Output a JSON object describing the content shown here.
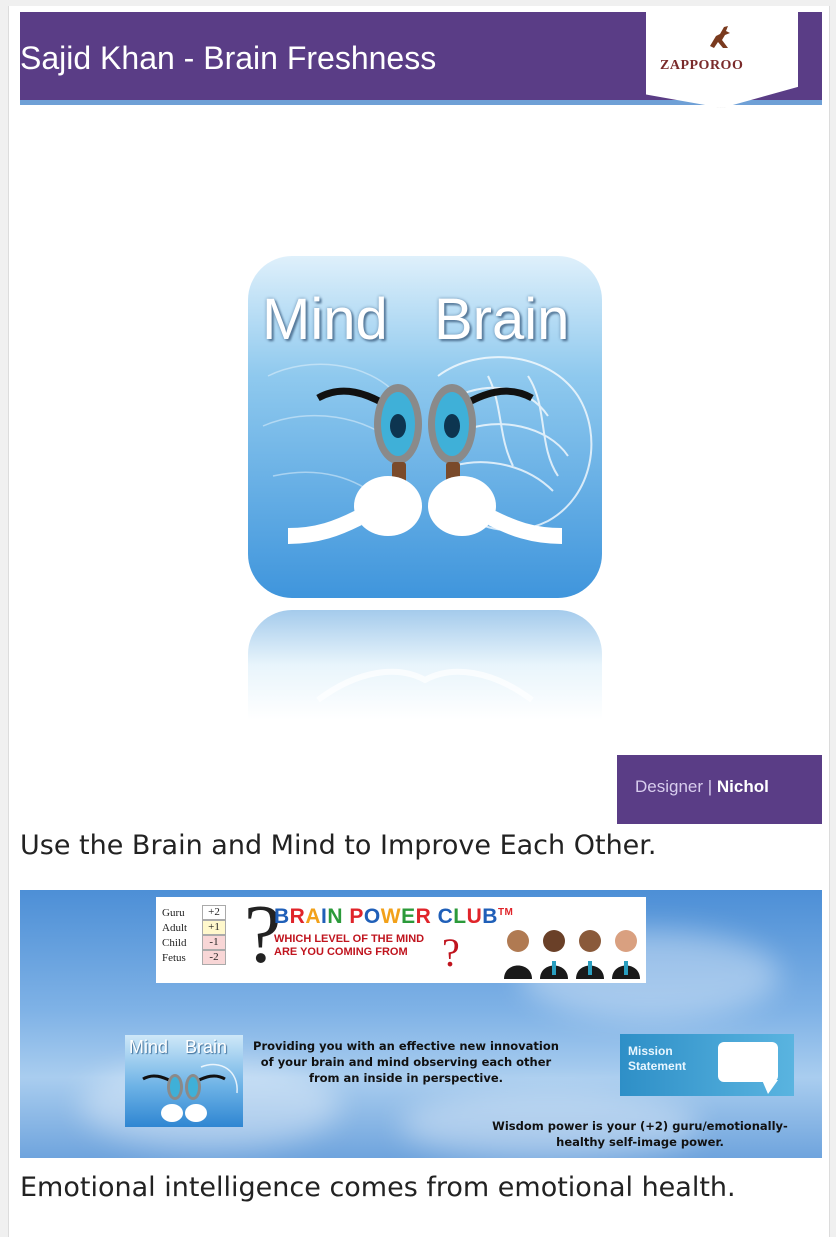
{
  "slide1": {
    "title": "Sajid Khan - Brain Freshness",
    "logo": "ZAPPOROO",
    "icon_words": [
      "Mind",
      "Brain"
    ],
    "designer_label": "Designer | ",
    "designer_name": "Nichol",
    "colors": {
      "header": "#5a3d86",
      "accent_line": "#6fa0d6",
      "icon_blue": "#3f95dc"
    }
  },
  "caption1": "Use the Brain and Mind to Improve Each Other.",
  "slide2": {
    "levels": [
      {
        "name": "Guru",
        "value": "+2",
        "color": "#ffffff"
      },
      {
        "name": "Adult",
        "value": "+1",
        "color": "#fff8cc"
      },
      {
        "name": "Child",
        "value": "-1",
        "color": "#f8d6d6"
      },
      {
        "name": "Fetus",
        "value": "-2",
        "color": "#f8d6d6"
      }
    ],
    "club_title": "BRAIN POWER CLUB",
    "club_tm": "TM",
    "club_sub_1": "WHICH LEVEL OF THE MIND",
    "club_sub_2": "ARE YOU COMING FROM",
    "small_icon_words": [
      "Mind",
      "Brain"
    ],
    "provide_text": "Providing you with an effective new innovation of your brain and mind observing each other from an inside in perspective.",
    "mission_1": "Mission",
    "mission_2": "Statement",
    "wisdom_text": "Wisdom power is your (+2) guru/emotionally-healthy self-image power."
  },
  "caption2": "Emotional intelligence comes from emotional health."
}
